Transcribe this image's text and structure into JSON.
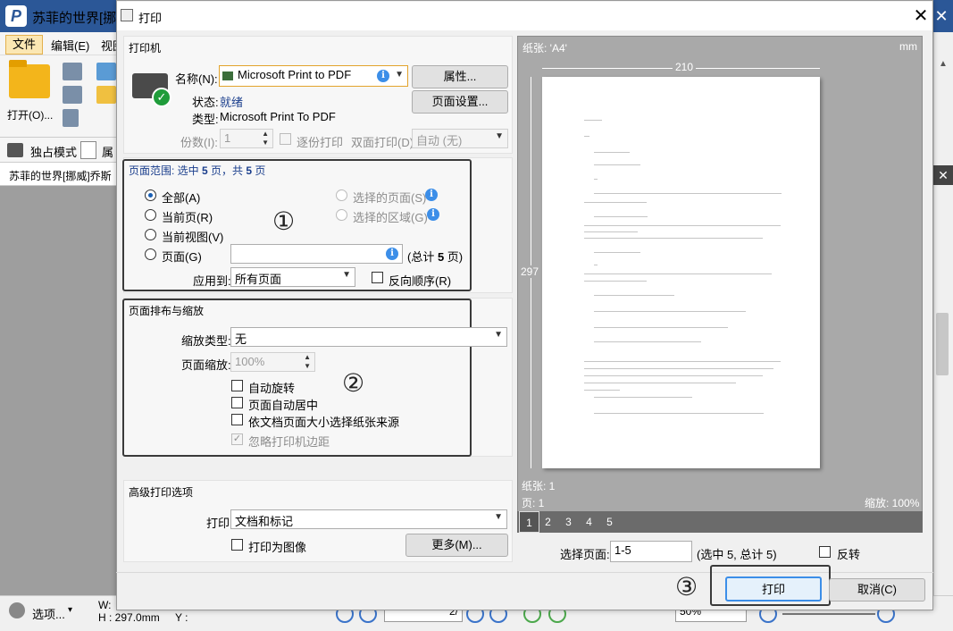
{
  "app": {
    "title": "苏菲的世界[挪",
    "logo_letter": "P",
    "menu": {
      "file": "文件",
      "edit": "编辑(E)",
      "view": "视图"
    },
    "ribbon": {
      "open_label": "打开(O)...",
      "exclusive_mode": "独占模式",
      "attr_label": "属"
    },
    "doc_tab": "苏菲的世界[挪威]乔斯",
    "status": {
      "options": "选项...",
      "width": "W:",
      "height": "H : 297.0mm",
      "y": "Y :",
      "page_num": "2/",
      "zoom": "50%"
    }
  },
  "dialog": {
    "title": "打印",
    "close": "✕",
    "printer": {
      "section": "打印机",
      "name_label": "名称(N):",
      "name_value": "Microsoft Print to PDF",
      "properties_button": "属性...",
      "page_setup_button": "页面设置...",
      "status_label": "状态:",
      "status_value": "就绪",
      "type_label": "类型:",
      "type_value": "Microsoft Print To PDF",
      "copies_label": "份数(I):",
      "copies_value": "1",
      "collate_label": "逐份打印",
      "duplex_label": "双面打印(D)",
      "duplex_value": "自动 (无)"
    },
    "range": {
      "header_prefix": "页面范围: 选中 ",
      "selected": "5",
      "header_mid": " 页，共 ",
      "total": "5",
      "header_suffix": " 页",
      "all": "全部(A)",
      "current_page": "当前页(R)",
      "current_view": "当前视图(V)",
      "pages": "页面(G)",
      "pages_value": "",
      "total_note_prefix": "(总计 ",
      "total_note_num": "5",
      "total_note_suffix": " 页)",
      "selected_pages": "选择的页面(S)",
      "selected_area": "选择的区域(G)",
      "apply_to_label": "应用到:",
      "apply_to_value": "所有页面",
      "reverse_label": "反向顺序(R)"
    },
    "layout": {
      "section": "页面排布与缩放",
      "scale_type_label": "缩放类型:",
      "scale_type_value": "无",
      "page_scale_label": "页面缩放:",
      "page_scale_value": "100%",
      "auto_rotate": "自动旋转",
      "auto_center": "页面自动居中",
      "choose_paper": "依文档页面大小选择纸张来源",
      "ignore_margins": "忽略打印机边距"
    },
    "advanced": {
      "section": "高级打印选项",
      "print_label": "打印",
      "print_value": "文档和标记",
      "as_image": "打印为图像",
      "more_button": "更多(M)..."
    },
    "preview": {
      "paper": "纸张: 'A4'",
      "unit": "mm",
      "width": "210",
      "height": "297",
      "paper_count": "纸张: 1",
      "page_count": "页: 1",
      "zoom": "缩放: 100%",
      "pages": [
        "1",
        "2",
        "3",
        "4",
        "5"
      ],
      "active_page": "1"
    },
    "select_pages_label": "选择页面:",
    "select_pages_value": "1-5",
    "select_note": "(选中 5, 总计 5)",
    "invert_label": "反转",
    "print_button": "打印",
    "cancel_button": "取消(C)",
    "annotations": [
      "①",
      "②",
      "③"
    ]
  },
  "colors": {
    "title_bar": "#2b5797",
    "accent": "#1a5fb4",
    "info": "#3c8ee8"
  }
}
